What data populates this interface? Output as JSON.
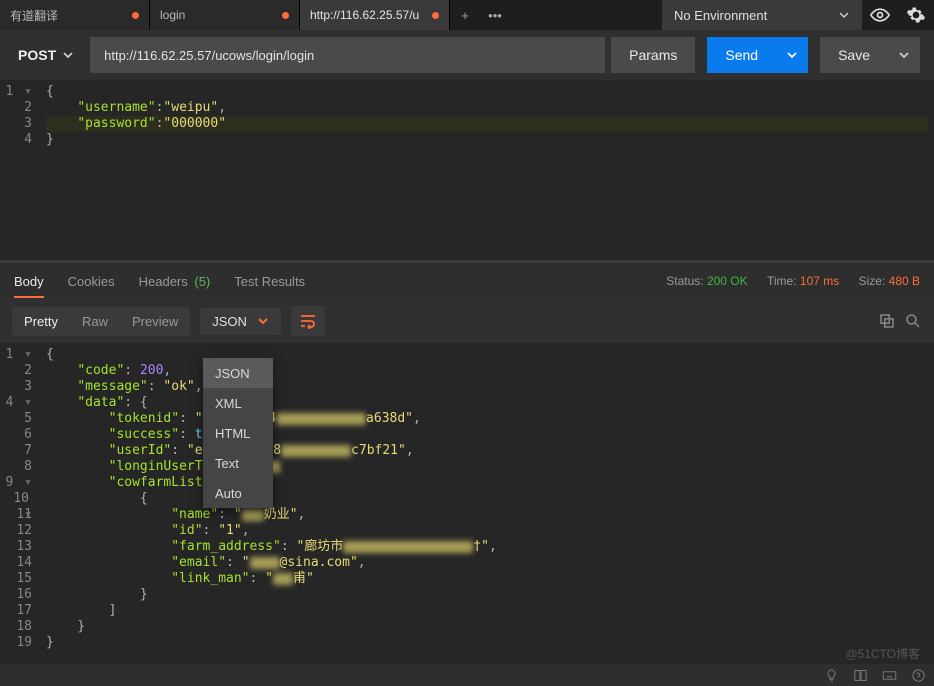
{
  "tabs": [
    {
      "label": "有道翻译",
      "modified": true,
      "active": false
    },
    {
      "label": "login",
      "modified": true,
      "active": false
    },
    {
      "label": "http://116.62.25.57/u",
      "modified": true,
      "active": true
    }
  ],
  "env": {
    "label": "No Environment"
  },
  "request": {
    "method": "POST",
    "url": "http://116.62.25.57/ucows/login/login",
    "params_btn": "Params",
    "send_btn": "Send",
    "save_btn": "Save"
  },
  "request_body_lines": [
    {
      "n": "1",
      "fold": true,
      "segs": [
        {
          "t": "{",
          "c": "tkb"
        }
      ]
    },
    {
      "n": "2",
      "segs": [
        {
          "t": "    ",
          "c": ""
        },
        {
          "t": "\"username\"",
          "c": "tkk"
        },
        {
          "t": ":",
          "c": "tkc"
        },
        {
          "t": "\"weipu\"",
          "c": "tks"
        },
        {
          "t": ",",
          "c": "tkc"
        }
      ]
    },
    {
      "n": "3",
      "hl": true,
      "segs": [
        {
          "t": "    ",
          "c": ""
        },
        {
          "t": "\"password\"",
          "c": "tkk"
        },
        {
          "t": ":",
          "c": "tkc"
        },
        {
          "t": "\"000000\"",
          "c": "tks"
        }
      ]
    },
    {
      "n": "4",
      "segs": [
        {
          "t": "}",
          "c": "tkb"
        }
      ]
    }
  ],
  "response_tabs": {
    "items": [
      {
        "label": "Body",
        "active": true
      },
      {
        "label": "Cookies"
      },
      {
        "label": "Headers",
        "count": "(5)"
      },
      {
        "label": "Test Results"
      }
    ]
  },
  "status": {
    "status_lbl": "Status:",
    "status_val": "200 OK",
    "time_lbl": "Time:",
    "time_val": "107 ms",
    "size_lbl": "Size:",
    "size_val": "480 B"
  },
  "body_toolbar": {
    "modes": [
      {
        "label": "Pretty",
        "active": true
      },
      {
        "label": "Raw"
      },
      {
        "label": "Preview"
      }
    ],
    "format": "JSON",
    "format_options": [
      "JSON",
      "XML",
      "HTML",
      "Text",
      "Auto"
    ]
  },
  "response_body_lines": [
    {
      "n": "1",
      "fold": true,
      "segs": [
        {
          "t": "{",
          "c": "tkb"
        }
      ]
    },
    {
      "n": "2",
      "segs": [
        {
          "t": "    ",
          "c": ""
        },
        {
          "t": "\"code\"",
          "c": "tkk"
        },
        {
          "t": ": ",
          "c": "tkc"
        },
        {
          "t": "200",
          "c": "tkn"
        },
        {
          "t": ",",
          "c": "tkc"
        }
      ]
    },
    {
      "n": "3",
      "segs": [
        {
          "t": "    ",
          "c": ""
        },
        {
          "t": "\"message\"",
          "c": "tkk"
        },
        {
          "t": ": ",
          "c": "tkc"
        },
        {
          "t": "\"ok\"",
          "c": "tks"
        },
        {
          "t": ",",
          "c": "tkc"
        }
      ]
    },
    {
      "n": "4",
      "fold": true,
      "segs": [
        {
          "t": "    ",
          "c": ""
        },
        {
          "t": "\"data\"",
          "c": "tkk"
        },
        {
          "t": ": {",
          "c": "tkc"
        }
      ]
    },
    {
      "n": "5",
      "segs": [
        {
          "t": "        ",
          "c": ""
        },
        {
          "t": "\"tokenid\"",
          "c": "tkk"
        },
        {
          "t": ": ",
          "c": "tkc"
        },
        {
          "t": "\"d",
          "c": "tks"
        },
        {
          "r": 50
        },
        {
          "t": "54",
          "c": "tks"
        },
        {
          "r": 90
        },
        {
          "t": "a638d\"",
          "c": "tks"
        },
        {
          "t": ",",
          "c": "tkc"
        }
      ]
    },
    {
      "n": "6",
      "segs": [
        {
          "t": "        ",
          "c": ""
        },
        {
          "t": "\"success\"",
          "c": "tkk"
        },
        {
          "t": ": ",
          "c": "tkc"
        },
        {
          "t": "tr",
          "c": "tkt"
        },
        {
          "r": 18
        }
      ]
    },
    {
      "n": "7",
      "segs": [
        {
          "t": "        ",
          "c": ""
        },
        {
          "t": "\"userId\"",
          "c": "tkk"
        },
        {
          "t": ": ",
          "c": "tkc"
        },
        {
          "t": "\"e5",
          "c": "tks"
        },
        {
          "r": 55
        },
        {
          "t": "48",
          "c": "tks"
        },
        {
          "r": 70
        },
        {
          "t": "c7bf21\"",
          "c": "tks"
        },
        {
          "t": ",",
          "c": "tkc"
        }
      ]
    },
    {
      "n": "8",
      "segs": [
        {
          "t": "        ",
          "c": ""
        },
        {
          "t": "\"longinUserTy",
          "c": "tkk"
        },
        {
          "r": 70
        }
      ]
    },
    {
      "n": "9",
      "fold": true,
      "segs": [
        {
          "t": "        ",
          "c": ""
        },
        {
          "t": "\"cowfarmList\"",
          "c": "tkk"
        },
        {
          "r": 20
        }
      ]
    },
    {
      "n": "10",
      "fold": true,
      "segs": [
        {
          "t": "            {",
          "c": "tkb"
        }
      ]
    },
    {
      "n": "11",
      "segs": [
        {
          "t": "                ",
          "c": ""
        },
        {
          "t": "\"name\"",
          "c": "tkk"
        },
        {
          "t": ": ",
          "c": "tkc"
        },
        {
          "t": "\"",
          "c": "tks"
        },
        {
          "r": 22
        },
        {
          "t": "奶业\"",
          "c": "tks"
        },
        {
          "t": ",",
          "c": "tkc"
        }
      ]
    },
    {
      "n": "12",
      "segs": [
        {
          "t": "                ",
          "c": ""
        },
        {
          "t": "\"id\"",
          "c": "tkk"
        },
        {
          "t": ": ",
          "c": "tkc"
        },
        {
          "t": "\"1\"",
          "c": "tks"
        },
        {
          "t": ",",
          "c": "tkc"
        }
      ]
    },
    {
      "n": "13",
      "segs": [
        {
          "t": "                ",
          "c": ""
        },
        {
          "t": "\"farm_address\"",
          "c": "tkk"
        },
        {
          "t": ": ",
          "c": "tkc"
        },
        {
          "t": "\"廊坊市",
          "c": "tks"
        },
        {
          "r": 130
        },
        {
          "t": "†\"",
          "c": "tks"
        },
        {
          "t": ",",
          "c": "tkc"
        }
      ]
    },
    {
      "n": "14",
      "segs": [
        {
          "t": "                ",
          "c": ""
        },
        {
          "t": "\"email\"",
          "c": "tkk"
        },
        {
          "t": ": ",
          "c": "tkc"
        },
        {
          "t": "\"",
          "c": "tks"
        },
        {
          "r": 30
        },
        {
          "t": "@sina.com\"",
          "c": "tks"
        },
        {
          "t": ",",
          "c": "tkc"
        }
      ]
    },
    {
      "n": "15",
      "segs": [
        {
          "t": "                ",
          "c": ""
        },
        {
          "t": "\"link_man\"",
          "c": "tkk"
        },
        {
          "t": ": ",
          "c": "tkc"
        },
        {
          "t": "\"",
          "c": "tks"
        },
        {
          "r": 20
        },
        {
          "t": "甫\"",
          "c": "tks"
        }
      ]
    },
    {
      "n": "16",
      "segs": [
        {
          "t": "            }",
          "c": "tkb"
        }
      ]
    },
    {
      "n": "17",
      "segs": [
        {
          "t": "        ]",
          "c": "tkb"
        }
      ]
    },
    {
      "n": "18",
      "segs": [
        {
          "t": "    }",
          "c": "tkb"
        }
      ]
    },
    {
      "n": "19",
      "segs": [
        {
          "t": "}",
          "c": "tkb"
        }
      ]
    }
  ],
  "watermark": "@51CTO博客"
}
